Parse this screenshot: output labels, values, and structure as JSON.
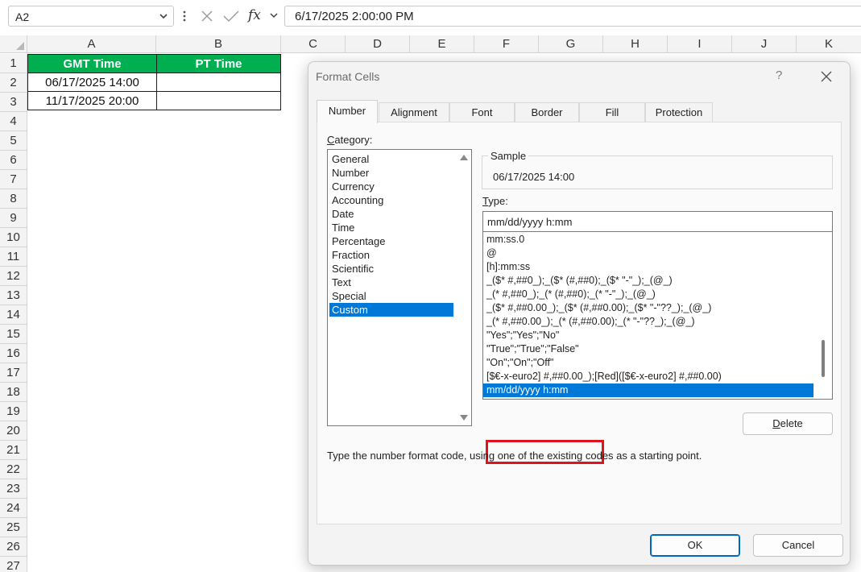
{
  "formula_bar": {
    "name_box": "A2",
    "cancel_icon": "close-icon",
    "enter_icon": "checkmark-icon",
    "fx_label": "fx",
    "formula": "6/17/2025  2:00:00 PM"
  },
  "grid": {
    "columns": [
      "A",
      "B",
      "C",
      "D",
      "E",
      "F",
      "G",
      "H",
      "I",
      "J",
      "K"
    ],
    "rows": [
      "1",
      "2",
      "3",
      "4",
      "5",
      "6",
      "7",
      "8",
      "9",
      "10",
      "11",
      "12",
      "13",
      "14",
      "15",
      "16",
      "17",
      "18",
      "19",
      "20",
      "21",
      "22",
      "23",
      "24",
      "25",
      "26",
      "27"
    ],
    "cells": {
      "a1": "GMT Time",
      "b1": "PT Time",
      "a2": "06/17/2025 14:00",
      "b2": "",
      "a3": "11/17/2025 20:00",
      "b3": ""
    },
    "header_fill": "#00b050"
  },
  "dialog": {
    "title": "Format Cells",
    "help": "?",
    "tabs": [
      "Number",
      "Alignment",
      "Font",
      "Border",
      "Fill",
      "Protection"
    ],
    "active_tab": "Number",
    "category_label_first": "C",
    "category_label_rest": "ategory:",
    "categories": [
      "General",
      "Number",
      "Currency",
      "Accounting",
      "Date",
      "Time",
      "Percentage",
      "Fraction",
      "Scientific",
      "Text",
      "Special",
      "Custom"
    ],
    "selected_category": "Custom",
    "sample_label": "Sample",
    "sample_value": "06/17/2025 14:00",
    "type_label_first": "T",
    "type_label_rest": "ype:",
    "type_value": "mm/dd/yyyy h:mm",
    "format_codes": [
      "mm:ss.0",
      "@",
      "[h]:mm:ss",
      "_($* #,##0_);_($* (#,##0);_($* \"-\"_);_(@_)",
      "_(* #,##0_);_(* (#,##0);_(* \"-\"_);_(@_)",
      "_($* #,##0.00_);_($* (#,##0.00);_($* \"-\"??_);_(@_)",
      "_(* #,##0.00_);_(* (#,##0.00);_(* \"-\"??_);_(@_)",
      "\"Yes\";\"Yes\";\"No\"",
      "\"True\";\"True\";\"False\"",
      "\"On\";\"On\";\"Off\"",
      "[$€-x-euro2] #,##0.00_);[Red]([$€-x-euro2] #,##0.00)",
      "mm/dd/yyyy h:mm"
    ],
    "selected_format": "mm/dd/yyyy h:mm",
    "delete_first": "D",
    "delete_rest": "elete",
    "description": "Type the number format code, using one of the existing codes as a starting point.",
    "ok_label": "OK",
    "cancel_label": "Cancel",
    "highlight_color": "#e0131c",
    "accent_color": "#0078d7"
  }
}
